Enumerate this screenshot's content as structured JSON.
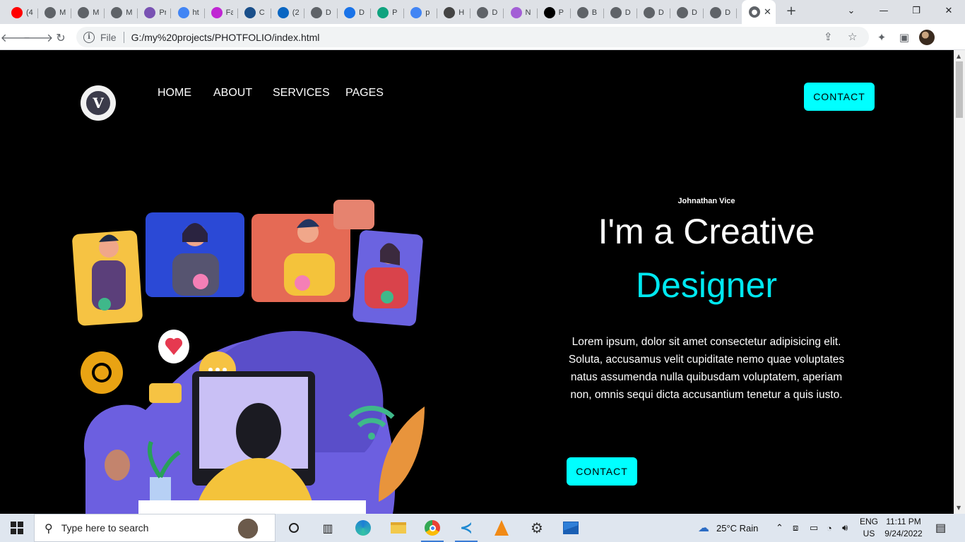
{
  "browser": {
    "tabs": [
      {
        "icon": "youtube-icon",
        "title": "(4",
        "color": "#ff0000"
      },
      {
        "icon": "globe-icon",
        "title": "M",
        "color": "#5f6368"
      },
      {
        "icon": "globe-icon",
        "title": "M",
        "color": "#5f6368"
      },
      {
        "icon": "globe-icon",
        "title": "M",
        "color": "#5f6368"
      },
      {
        "icon": "bootstrap-icon",
        "title": "Pr",
        "color": "#7952b3"
      },
      {
        "icon": "google-icon",
        "title": "ht",
        "color": "#4285f4"
      },
      {
        "icon": "figma-icon",
        "title": "Fa",
        "color": "#c026d3"
      },
      {
        "icon": "globe-icon",
        "title": "C",
        "color": "#1a4f8a"
      },
      {
        "icon": "linkedin-icon",
        "title": "(2",
        "color": "#0a66c2"
      },
      {
        "icon": "globe-icon",
        "title": "D",
        "color": "#5f6368"
      },
      {
        "icon": "download-icon",
        "title": "D",
        "color": "#1a73e8"
      },
      {
        "icon": "p-icon",
        "title": "P",
        "color": "#10a37f"
      },
      {
        "icon": "google-icon",
        "title": "p",
        "color": "#4285f4"
      },
      {
        "icon": "avatar-icon",
        "title": "H",
        "color": "#444444"
      },
      {
        "icon": "globe-icon",
        "title": "D",
        "color": "#5f6368"
      },
      {
        "icon": "m-icon",
        "title": "N",
        "color": "#a35fd6"
      },
      {
        "icon": "p-black-icon",
        "title": "P",
        "color": "#000000"
      },
      {
        "icon": "globe-icon",
        "title": "B",
        "color": "#5f6368"
      },
      {
        "icon": "globe-icon",
        "title": "D",
        "color": "#5f6368"
      },
      {
        "icon": "globe-icon",
        "title": "D",
        "color": "#5f6368"
      },
      {
        "icon": "globe-icon",
        "title": "D",
        "color": "#5f6368"
      },
      {
        "icon": "globe-icon",
        "title": "D",
        "color": "#5f6368"
      }
    ],
    "address": {
      "scheme_label": "File",
      "url": "G:/my%20projects/PHOTFOLIO/index.html"
    }
  },
  "site": {
    "logo_letter": "V",
    "nav": [
      "HOME",
      "ABOUT",
      "SERVICES",
      "PAGES"
    ],
    "header_button": "CONTACT",
    "hero": {
      "name": "Johnathan Vice",
      "title_line1": "I'm a Creative",
      "title_line2": "Designer",
      "text": "Lorem ipsum, dolor sit amet consectetur adipisicing elit. Soluta, accusamus velit cupiditate nemo quae voluptates natus assumenda nulla quibusdam voluptatem, aperiam non, omnis sequi dicta accusantium tenetur a quis iusto.",
      "button": "CONTACT"
    },
    "accent": "#00ffff"
  },
  "taskbar": {
    "search_placeholder": "Type here to search",
    "weather": "25°C  Rain",
    "lang_top": "ENG",
    "lang_bottom": "US",
    "time": "11:11 PM",
    "date": "9/24/2022"
  }
}
